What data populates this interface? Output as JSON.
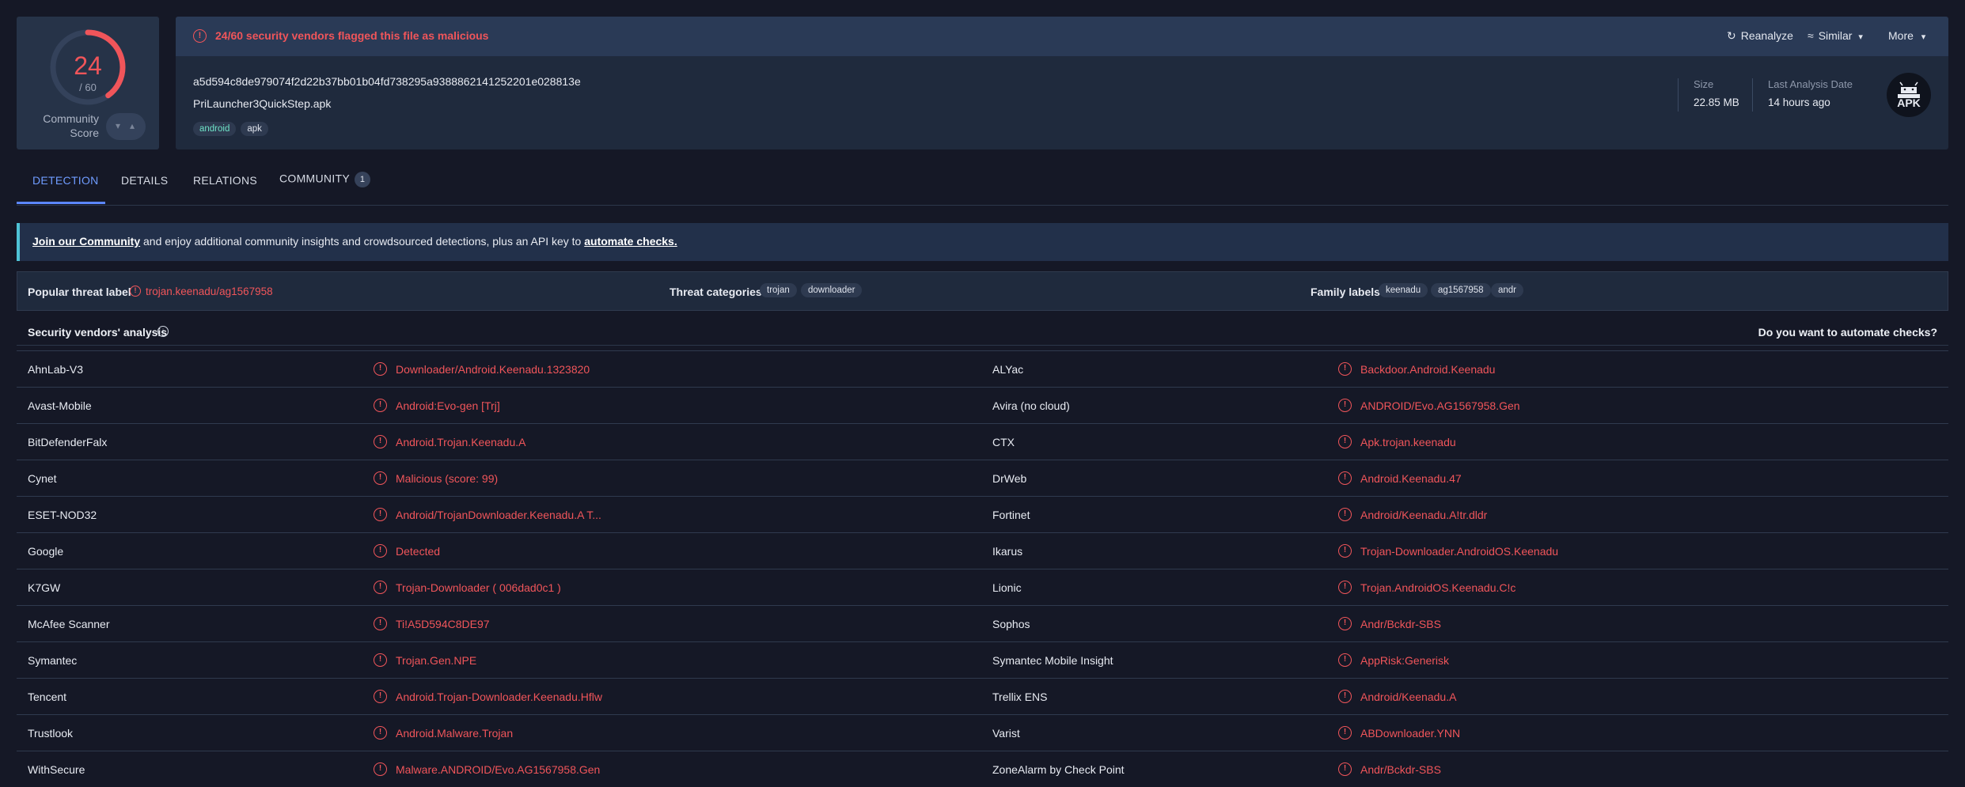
{
  "score": {
    "detections": "24",
    "total": "/ 60",
    "detection_fraction": 0.4,
    "community_label_1": "Community",
    "community_label_2": "Score"
  },
  "alert": {
    "text": "24/60 security vendors flagged this file as malicious",
    "buttons": {
      "reanalyze": "Reanalyze",
      "similar": "Similar",
      "more": "More"
    }
  },
  "file": {
    "hash": "a5d594c8de979074f2d22b37bb01b04fd738295a9388862141252201e028813e",
    "name": "PriLauncher3QuickStep.apk",
    "tags": [
      "android",
      "apk"
    ],
    "size_label": "Size",
    "size_value": "22.85 MB",
    "date_label": "Last Analysis Date",
    "date_value": "14 hours ago",
    "type_icon": "APK"
  },
  "tabs": [
    {
      "label": "DETECTION"
    },
    {
      "label": "DETAILS"
    },
    {
      "label": "RELATIONS"
    },
    {
      "label": "COMMUNITY",
      "badge": "1"
    }
  ],
  "banner": {
    "link1": "Join our Community",
    "middle": " and enjoy additional community insights and crowdsourced detections, plus an API key to ",
    "link2": "automate checks."
  },
  "threat": {
    "popular_label": "Popular threat label",
    "popular_value": "trojan.keenadu/ag1567958",
    "categories_label": "Threat categories",
    "categories": [
      "trojan",
      "downloader"
    ],
    "family_label": "Family labels",
    "families": [
      "keenadu",
      "ag1567958",
      "andr"
    ]
  },
  "vendors": {
    "title": "Security vendors' analysis",
    "automate": "Do you want to automate checks?",
    "rows": [
      {
        "v1": "AhnLab-V3",
        "r1": "Downloader/Android.Keenadu.1323820",
        "v2": "ALYac",
        "r2": "Backdoor.Android.Keenadu"
      },
      {
        "v1": "Avast-Mobile",
        "r1": "Android:Evo-gen [Trj]",
        "v2": "Avira (no cloud)",
        "r2": "ANDROID/Evo.AG1567958.Gen"
      },
      {
        "v1": "BitDefenderFalx",
        "r1": "Android.Trojan.Keenadu.A",
        "v2": "CTX",
        "r2": "Apk.trojan.keenadu"
      },
      {
        "v1": "Cynet",
        "r1": "Malicious (score: 99)",
        "v2": "DrWeb",
        "r2": "Android.Keenadu.47"
      },
      {
        "v1": "ESET-NOD32",
        "r1": "Android/TrojanDownloader.Keenadu.A T...",
        "v2": "Fortinet",
        "r2": "Android/Keenadu.A!tr.dldr"
      },
      {
        "v1": "Google",
        "r1": "Detected",
        "v2": "Ikarus",
        "r2": "Trojan-Downloader.AndroidOS.Keenadu"
      },
      {
        "v1": "K7GW",
        "r1": "Trojan-Downloader ( 006dad0c1 )",
        "v2": "Lionic",
        "r2": "Trojan.AndroidOS.Keenadu.C!c"
      },
      {
        "v1": "McAfee Scanner",
        "r1": "Ti!A5D594C8DE97",
        "v2": "Sophos",
        "r2": "Andr/Bckdr-SBS"
      },
      {
        "v1": "Symantec",
        "r1": "Trojan.Gen.NPE",
        "v2": "Symantec Mobile Insight",
        "r2": "AppRisk:Generisk"
      },
      {
        "v1": "Tencent",
        "r1": "Android.Trojan-Downloader.Keenadu.Hflw",
        "v2": "Trellix ENS",
        "r2": "Android/Keenadu.A"
      },
      {
        "v1": "Trustlook",
        "r1": "Android.Malware.Trojan",
        "v2": "Varist",
        "r2": "ABDownloader.YNN"
      },
      {
        "v1": "WithSecure",
        "r1": "Malware.ANDROID/Evo.AG1567958.Gen",
        "v2": "ZoneAlarm by Check Point",
        "r2": "Andr/Bckdr-SBS"
      }
    ]
  },
  "colors": {
    "malicious": "#f0555a",
    "accent": "#5b86ff",
    "background": "#151826"
  }
}
